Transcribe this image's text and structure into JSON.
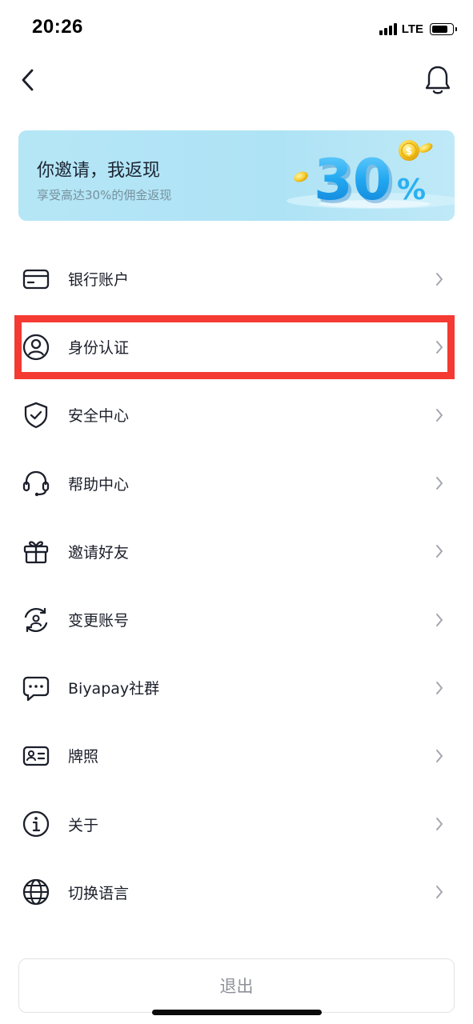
{
  "status_bar": {
    "time": "20:26",
    "network": "LTE"
  },
  "header": {
    "back_icon": "chevron-left-icon",
    "notification_icon": "bell-icon"
  },
  "banner": {
    "title": "你邀请，我返现",
    "subtitle": "享受高达30%的佣金返现",
    "promo_number": "30",
    "promo_unit": "%"
  },
  "menu": {
    "items": [
      {
        "label": "银行账户",
        "icon": "bank-card-icon"
      },
      {
        "label": "身份认证",
        "icon": "user-circle-icon"
      },
      {
        "label": "安全中心",
        "icon": "shield-check-icon"
      },
      {
        "label": "帮助中心",
        "icon": "headset-icon"
      },
      {
        "label": "邀请好友",
        "icon": "gift-icon"
      },
      {
        "label": "变更账号",
        "icon": "switch-account-icon"
      },
      {
        "label": "Biyapay社群",
        "icon": "chat-bubble-icon"
      },
      {
        "label": "牌照",
        "icon": "license-card-icon"
      },
      {
        "label": "关于",
        "icon": "info-icon"
      },
      {
        "label": "切换语言",
        "icon": "globe-icon"
      }
    ]
  },
  "logout": {
    "label": "退出"
  },
  "colors": {
    "highlight": "#f43a32",
    "banner_bg": "#aee3f5",
    "text": "#1b1f2a",
    "muted": "#8d9198"
  }
}
